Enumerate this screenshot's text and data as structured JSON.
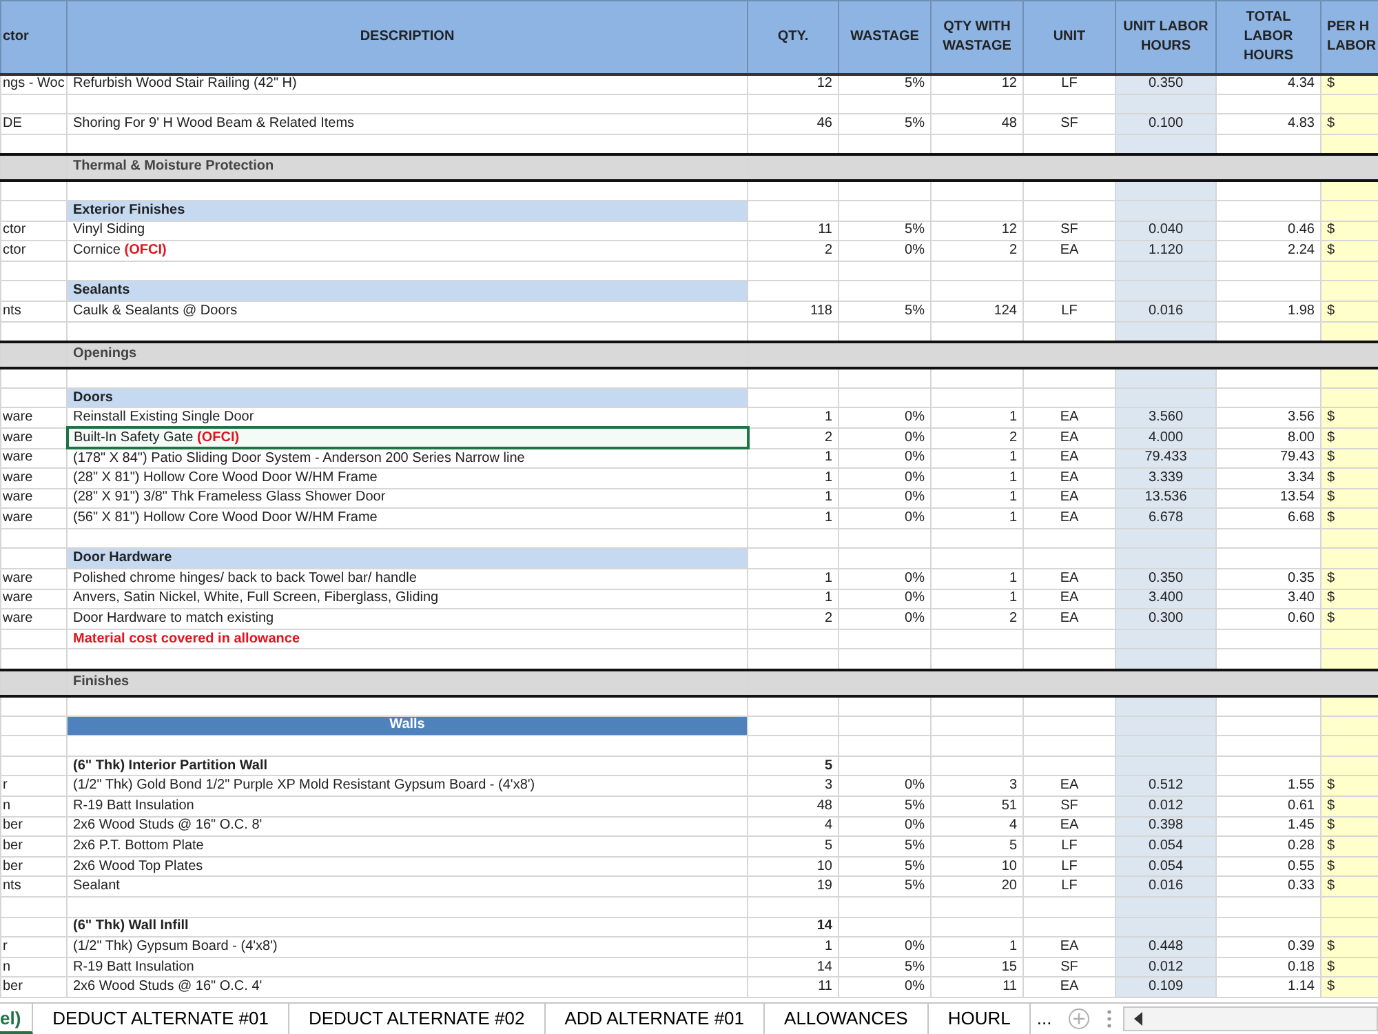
{
  "columns": [
    {
      "label": "ctor"
    },
    {
      "label": "DESCRIPTION"
    },
    {
      "label": "QTY."
    },
    {
      "label": "WASTAGE"
    },
    {
      "label": "QTY WITH WASTAGE"
    },
    {
      "label": "UNIT"
    },
    {
      "label": "UNIT LABOR HOURS"
    },
    {
      "label": "TOTAL LABOR HOURS"
    },
    {
      "label": "PER H LABOR"
    }
  ],
  "rows": [
    {
      "kind": "item",
      "selected": false,
      "col_a": "ngs - Woc",
      "description": "Refurbish Wood Stair Railing (42\" H)",
      "qty": "12",
      "wastage": "5%",
      "qty_with_wastage": "12",
      "unit": "LF",
      "unit_labor_hours": "0.350",
      "total_labor_hours": "4.34",
      "per_hour": "$"
    },
    {
      "kind": "blank"
    },
    {
      "kind": "item",
      "selected": false,
      "col_a": "DE",
      "description": "Shoring For 9' H Wood Beam & Related Items",
      "qty": "46",
      "wastage": "5%",
      "qty_with_wastage": "48",
      "unit": "SF",
      "unit_labor_hours": "0.100",
      "total_labor_hours": "4.83",
      "per_hour": "$"
    },
    {
      "kind": "blank"
    },
    {
      "kind": "section",
      "description": "Thermal & Moisture Protection"
    },
    {
      "kind": "blank"
    },
    {
      "kind": "subheader",
      "description": "Exterior Finishes"
    },
    {
      "kind": "item",
      "selected": false,
      "col_a": "ctor",
      "description": "Vinyl Siding",
      "qty": "11",
      "wastage": "5%",
      "qty_with_wastage": "12",
      "unit": "SF",
      "unit_labor_hours": "0.040",
      "total_labor_hours": "0.46",
      "per_hour": "$"
    },
    {
      "kind": "item",
      "selected": false,
      "col_a": "ctor",
      "description": "Cornice",
      "tag": "(OFCI)",
      "qty": "2",
      "wastage": "0%",
      "qty_with_wastage": "2",
      "unit": "EA",
      "unit_labor_hours": "1.120",
      "total_labor_hours": "2.24",
      "per_hour": "$"
    },
    {
      "kind": "blank"
    },
    {
      "kind": "subheader",
      "description": "Sealants"
    },
    {
      "kind": "item",
      "selected": false,
      "col_a": "nts",
      "description": "Caulk & Sealants @ Doors",
      "qty": "118",
      "wastage": "5%",
      "qty_with_wastage": "124",
      "unit": "LF",
      "unit_labor_hours": "0.016",
      "total_labor_hours": "1.98",
      "per_hour": "$"
    },
    {
      "kind": "blank"
    },
    {
      "kind": "section",
      "description": "Openings"
    },
    {
      "kind": "blank"
    },
    {
      "kind": "subheader",
      "description": "Doors"
    },
    {
      "kind": "item",
      "selected": false,
      "col_a": "ware",
      "description": "Reinstall Existing Single Door",
      "qty": "1",
      "wastage": "0%",
      "qty_with_wastage": "1",
      "unit": "EA",
      "unit_labor_hours": "3.560",
      "total_labor_hours": "3.56",
      "per_hour": "$"
    },
    {
      "kind": "item",
      "selected": true,
      "col_a": "ware",
      "description": "Built-In Safety Gate",
      "tag": "(OFCI)",
      "qty": "2",
      "wastage": "0%",
      "qty_with_wastage": "2",
      "unit": "EA",
      "unit_labor_hours": "4.000",
      "total_labor_hours": "8.00",
      "per_hour": "$"
    },
    {
      "kind": "item",
      "selected": false,
      "col_a": "ware",
      "description": "(178\" X 84\") Patio Sliding Door System - Anderson 200 Series Narrow line",
      "qty": "1",
      "wastage": "0%",
      "qty_with_wastage": "1",
      "unit": "EA",
      "unit_labor_hours": "79.433",
      "total_labor_hours": "79.43",
      "per_hour": "$"
    },
    {
      "kind": "item",
      "selected": false,
      "col_a": "ware",
      "description": "(28\" X 81\") Hollow Core Wood Door W/HM Frame",
      "qty": "1",
      "wastage": "0%",
      "qty_with_wastage": "1",
      "unit": "EA",
      "unit_labor_hours": "3.339",
      "total_labor_hours": "3.34",
      "per_hour": "$"
    },
    {
      "kind": "item",
      "selected": false,
      "col_a": "ware",
      "description": "(28\" X 91\") 3/8\" Thk Frameless Glass Shower Door",
      "qty": "1",
      "wastage": "0%",
      "qty_with_wastage": "1",
      "unit": "EA",
      "unit_labor_hours": "13.536",
      "total_labor_hours": "13.54",
      "per_hour": "$"
    },
    {
      "kind": "item",
      "selected": false,
      "col_a": "ware",
      "description": "(56\" X 81\") Hollow Core Wood Door W/HM Frame",
      "qty": "1",
      "wastage": "0%",
      "qty_with_wastage": "1",
      "unit": "EA",
      "unit_labor_hours": "6.678",
      "total_labor_hours": "6.68",
      "per_hour": "$"
    },
    {
      "kind": "blank"
    },
    {
      "kind": "subheader",
      "description": "Door Hardware"
    },
    {
      "kind": "item",
      "selected": false,
      "col_a": "ware",
      "description": "Polished chrome hinges/ back to back Towel bar/ handle",
      "qty": "1",
      "wastage": "0%",
      "qty_with_wastage": "1",
      "unit": "EA",
      "unit_labor_hours": "0.350",
      "total_labor_hours": "0.35",
      "per_hour": "$"
    },
    {
      "kind": "item",
      "selected": false,
      "col_a": "ware",
      "description": "Anvers, Satin Nickel, White, Full Screen, Fiberglass, Gliding",
      "qty": "1",
      "wastage": "0%",
      "qty_with_wastage": "1",
      "unit": "EA",
      "unit_labor_hours": "3.400",
      "total_labor_hours": "3.40",
      "per_hour": "$"
    },
    {
      "kind": "item",
      "selected": false,
      "col_a": "ware",
      "description": "Door Hardware to match existing",
      "qty": "2",
      "wastage": "0%",
      "qty_with_wastage": "2",
      "unit": "EA",
      "unit_labor_hours": "0.300",
      "total_labor_hours": "0.60",
      "per_hour": "$"
    },
    {
      "kind": "note",
      "description": "Material cost covered in allowance"
    },
    {
      "kind": "blank"
    },
    {
      "kind": "section",
      "description": "Finishes"
    },
    {
      "kind": "blank"
    },
    {
      "kind": "band",
      "description": "Walls"
    },
    {
      "kind": "blank"
    },
    {
      "kind": "group",
      "description": "(6\" Thk) Interior Partition Wall",
      "qty": "5"
    },
    {
      "kind": "item",
      "selected": false,
      "col_a": "r",
      "description": "(1/2\" Thk) Gold Bond 1/2\" Purple XP Mold Resistant Gypsum Board - (4'x8')",
      "qty": "3",
      "wastage": "0%",
      "qty_with_wastage": "3",
      "unit": "EA",
      "unit_labor_hours": "0.512",
      "total_labor_hours": "1.55",
      "per_hour": "$"
    },
    {
      "kind": "item",
      "selected": false,
      "col_a": "n",
      "description": "R-19 Batt Insulation",
      "qty": "48",
      "wastage": "5%",
      "qty_with_wastage": "51",
      "unit": "SF",
      "unit_labor_hours": "0.012",
      "total_labor_hours": "0.61",
      "per_hour": "$"
    },
    {
      "kind": "item",
      "selected": false,
      "col_a": "ber",
      "description": "2x6 Wood Studs @ 16\" O.C. 8'",
      "qty": "4",
      "wastage": "0%",
      "qty_with_wastage": "4",
      "unit": "EA",
      "unit_labor_hours": "0.398",
      "total_labor_hours": "1.45",
      "per_hour": "$"
    },
    {
      "kind": "item",
      "selected": false,
      "col_a": "ber",
      "description": "2x6 P.T. Bottom Plate",
      "qty": "5",
      "wastage": "5%",
      "qty_with_wastage": "5",
      "unit": "LF",
      "unit_labor_hours": "0.054",
      "total_labor_hours": "0.28",
      "per_hour": "$"
    },
    {
      "kind": "item",
      "selected": false,
      "col_a": "ber",
      "description": "2x6 Wood Top Plates",
      "qty": "10",
      "wastage": "5%",
      "qty_with_wastage": "10",
      "unit": "LF",
      "unit_labor_hours": "0.054",
      "total_labor_hours": "0.55",
      "per_hour": "$"
    },
    {
      "kind": "item",
      "selected": false,
      "col_a": "nts",
      "description": "Sealant",
      "qty": "19",
      "wastage": "5%",
      "qty_with_wastage": "20",
      "unit": "LF",
      "unit_labor_hours": "0.016",
      "total_labor_hours": "0.33",
      "per_hour": "$"
    },
    {
      "kind": "blank"
    },
    {
      "kind": "group",
      "description": "(6\" Thk) Wall Infill",
      "qty": "14"
    },
    {
      "kind": "item",
      "selected": false,
      "col_a": "r",
      "description": "(1/2\" Thk) Gypsum Board - (4'x8')",
      "qty": "1",
      "wastage": "0%",
      "qty_with_wastage": "1",
      "unit": "EA",
      "unit_labor_hours": "0.448",
      "total_labor_hours": "0.39",
      "per_hour": "$"
    },
    {
      "kind": "item",
      "selected": false,
      "col_a": "n",
      "description": "R-19 Batt Insulation",
      "qty": "14",
      "wastage": "5%",
      "qty_with_wastage": "15",
      "unit": "SF",
      "unit_labor_hours": "0.012",
      "total_labor_hours": "0.18",
      "per_hour": "$"
    },
    {
      "kind": "item",
      "selected": false,
      "col_a": "ber",
      "description": "2x6 Wood Studs @ 16\" O.C. 4'",
      "qty": "11",
      "wastage": "0%",
      "qty_with_wastage": "11",
      "unit": "EA",
      "unit_labor_hours": "0.109",
      "total_labor_hours": "1.14",
      "per_hour": "$"
    }
  ],
  "sheet_tabs": [
    {
      "label": "el)",
      "selected": true
    },
    {
      "label": "DEDUCT ALTERNATE #01",
      "selected": false
    },
    {
      "label": "DEDUCT ALTERNATE #02",
      "selected": false
    },
    {
      "label": "ADD ALTERNATE #01",
      "selected": false
    },
    {
      "label": "ALLOWANCES",
      "selected": false
    },
    {
      "label": "HOURL",
      "selected": false
    }
  ],
  "more_tabs": "..."
}
